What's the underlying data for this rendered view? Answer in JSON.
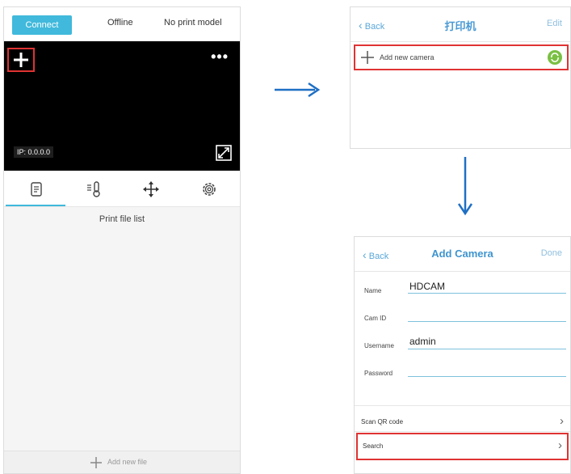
{
  "left_phone": {
    "connect_label": "Connect",
    "status": "Offline",
    "model": "No print model",
    "menu_dots": "•••",
    "ip": "IP: 0.0.0.0",
    "tabs": [
      {
        "icon": "file-icon"
      },
      {
        "icon": "thermometer-icon"
      },
      {
        "icon": "move-arrows-icon"
      },
      {
        "icon": "gear-icon"
      }
    ],
    "list_title": "Print file list",
    "add_file_label": "Add new file"
  },
  "printer_panel": {
    "back": "Back",
    "title": "打印机",
    "edit": "Edit",
    "add_camera": "Add new camera"
  },
  "add_camera_panel": {
    "back": "Back",
    "title": "Add Camera",
    "done": "Done",
    "fields": [
      {
        "label": "Name",
        "value": "HDCAM"
      },
      {
        "label": "Cam ID",
        "value": ""
      },
      {
        "label": "Username",
        "value": "admin"
      },
      {
        "label": "Password",
        "value": ""
      }
    ],
    "scan_qr": "Scan QR code",
    "search": "Search",
    "chevron": "›"
  },
  "colors": {
    "accent": "#40b9dc",
    "highlight": "#e03333",
    "nav_text": "#4a9ad4",
    "arrow": "#1f6fc4"
  }
}
